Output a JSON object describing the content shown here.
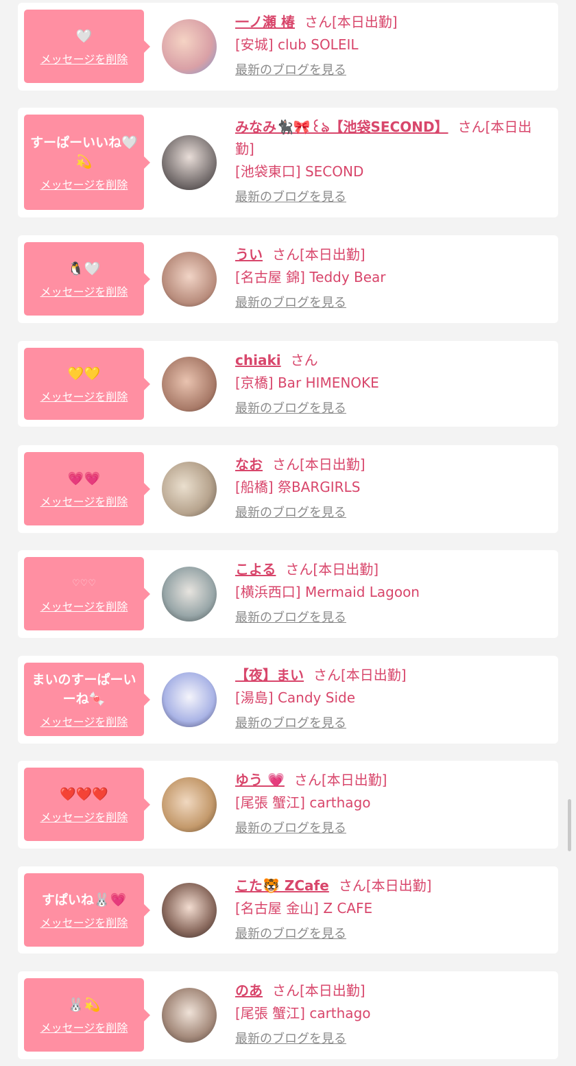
{
  "common": {
    "delete_label": "メッセージを削除",
    "blog_label": "最新のブログを見る",
    "san_label": "さん"
  },
  "colors": {
    "page_bg": "#f3f3f3",
    "bubble_bg": "#ff8fa2",
    "accent": "#d8466b",
    "muted_link": "#8a8a8a"
  },
  "cards": [
    {
      "message": "🤍",
      "name": "一ノ瀬 椿",
      "status": "[本日出勤]",
      "shop": "[安城] club SOLEIL"
    },
    {
      "message": "すーぱーいいね🤍💫",
      "name": "みなみ🐈‍⬛🎀꒰ঌ【池袋SECOND】",
      "status": "[本日出勤]",
      "shop": "[池袋東口] SECOND"
    },
    {
      "message": "🐧🤍",
      "name": "うい",
      "status": "[本日出勤]",
      "shop": "[名古屋 錦] Teddy Bear"
    },
    {
      "message": "💛💛",
      "name": "chiaki",
      "status": "",
      "shop": "[京橋] Bar HIMENOKE"
    },
    {
      "message": "💗💗",
      "name": "なお",
      "status": "[本日出勤]",
      "shop": "[船橋] 祭BARGIRLS"
    },
    {
      "message": "♡♡♡",
      "name": "こよる",
      "status": "[本日出勤]",
      "shop": "[横浜西口] Mermaid Lagoon"
    },
    {
      "message": "まいのすーぱーいーね🍬",
      "name": "【夜】まい",
      "status": "[本日出勤]",
      "shop": "[湯島] Candy Side"
    },
    {
      "message": "❤️❤️❤️",
      "name": "ゆう 💗",
      "status": "[本日出勤]",
      "shop": "[尾張 蟹江] carthago"
    },
    {
      "message": "すぱいね🐰💗",
      "name": "こた🐯 ZCafe",
      "status": "[本日出勤]",
      "shop": "[名古屋 金山] Z CAFE"
    },
    {
      "message": "🐰💫",
      "name": "のあ",
      "status": "[本日出勤]",
      "shop": "[尾張 蟹江] carthago"
    }
  ]
}
